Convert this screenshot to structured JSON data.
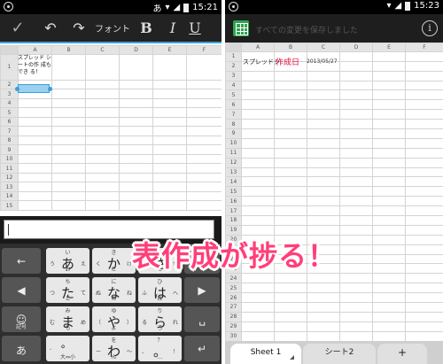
{
  "left": {
    "status": {
      "time": "15:21",
      "ime": "あ"
    },
    "toolbar": {
      "font_label": "フォント",
      "bold": "B",
      "italic": "I",
      "underline": "U",
      "check": "✓",
      "undo": "↶",
      "redo": "↷"
    },
    "columns": [
      "A",
      "B",
      "C",
      "D",
      "E",
      "F"
    ],
    "rows": [
      "1",
      "2",
      "3",
      "4",
      "5",
      "6",
      "7",
      "8",
      "9",
      "10",
      "11",
      "12",
      "13",
      "14",
      "15"
    ],
    "a1_text": "スプレッド シートの作 成もでき る！",
    "keyboard": {
      "row1": [
        {
          "t": "",
          "main": "←",
          "sub": "",
          "dark": true
        },
        {
          "t": "い",
          "l": "う",
          "main": "あ",
          "r": "え",
          "b": "お"
        },
        {
          "t": "き",
          "l": "く",
          "main": "か",
          "r": "け",
          "b": "こ"
        },
        {
          "t": "し",
          "l": "す",
          "main": "さ",
          "r": "せ",
          "b": "そ"
        },
        {
          "t": "",
          "main": "⌫",
          "sub": "",
          "dark": true
        }
      ],
      "row2": [
        {
          "t": "",
          "main": "◀",
          "sub": "",
          "dark": true
        },
        {
          "t": "ち",
          "l": "つ",
          "main": "た",
          "r": "て",
          "b": "と"
        },
        {
          "t": "に",
          "l": "ぬ",
          "main": "な",
          "r": "ね",
          "b": "の"
        },
        {
          "t": "ひ",
          "l": "ふ",
          "main": "は",
          "r": "へ",
          "b": "ほ"
        },
        {
          "t": "",
          "main": "▶",
          "sub": "",
          "dark": true
        }
      ],
      "row3": [
        {
          "t": "",
          "main": "☺",
          "sub": "記号",
          "dark": true
        },
        {
          "t": "み",
          "l": "む",
          "main": "ま",
          "r": "め",
          "b": "も"
        },
        {
          "t": "ゆ",
          "l": "（",
          "main": "や",
          "r": "）",
          "b": "よ"
        },
        {
          "t": "り",
          "l": "る",
          "main": "ら",
          "r": "れ",
          "b": "ろ"
        },
        {
          "t": "",
          "main": "␣",
          "sub": "",
          "dark": true
        }
      ],
      "row4": [
        {
          "t": "",
          "main": "あ",
          "sub": "",
          "dark": true
        },
        {
          "t": "",
          "l": "゛",
          "main": "゜",
          "r": "",
          "b": "大⇔小"
        },
        {
          "t": "を",
          "l": "ー",
          "main": "わ",
          "r": "〜",
          "b": "ん"
        },
        {
          "t": "？",
          "l": "、",
          "main": "。",
          "r": "！",
          "b": "…"
        },
        {
          "t": "",
          "main": "↵",
          "sub": "",
          "dark": true
        }
      ]
    }
  },
  "right": {
    "status": {
      "time": "15:23"
    },
    "toolbar": {
      "title": "すべての変更を保存しました",
      "info": "i"
    },
    "columns": [
      "A",
      "B",
      "C",
      "D",
      "E",
      "F"
    ],
    "rows": [
      "1",
      "2",
      "3",
      "4",
      "5",
      "6",
      "7",
      "8",
      "9",
      "10",
      "11",
      "12",
      "13",
      "14",
      "15",
      "16",
      "17",
      "18",
      "19",
      "20",
      "21",
      "22",
      "23",
      "24",
      "25",
      "26",
      "27",
      "28",
      "29",
      "30"
    ],
    "row1": {
      "a": "スプレッドシ",
      "b": "作成日",
      "c": "2013/05/27"
    },
    "tabs": {
      "sheet1": "Sheet 1",
      "sheet2": "シート2",
      "add": "+"
    }
  },
  "caption": "表作成が捗る！",
  "colors": {
    "accent": "#3aa0d8",
    "caption": "#ff3f7a",
    "red_text": "#e0103a",
    "sheets_green": "#2fa44f"
  }
}
